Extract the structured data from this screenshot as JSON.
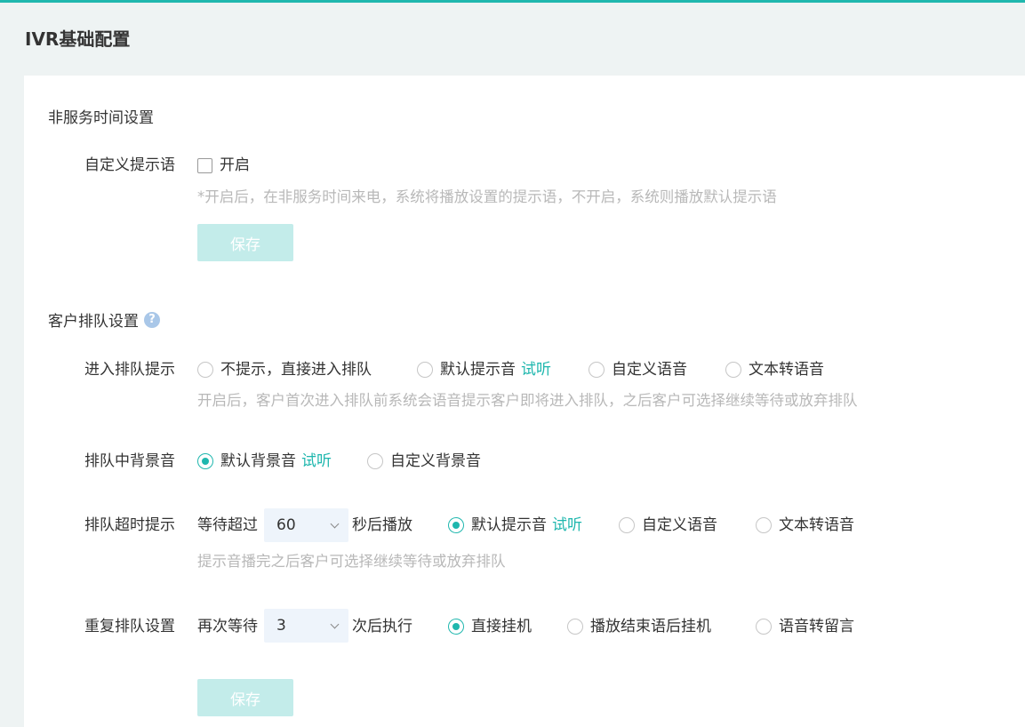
{
  "page": {
    "title": "IVR基础配置"
  },
  "colors": {
    "accent": "#1fb7ae",
    "button_disabled": "#c3ecea",
    "hint": "#b8b8b8"
  },
  "non_service": {
    "section_title": "非服务时间设置",
    "custom_prompt_label": "自定义提示语",
    "enable_label": "开启",
    "enable_checked": false,
    "hint": "*开启后，在非服务时间来电，系统将播放设置的提示语，不开启，系统则播放默认提示语",
    "save_label": "保存"
  },
  "queue": {
    "section_title": "客户排队设置",
    "help_icon": "?",
    "enter_prompt": {
      "label": "进入排队提示",
      "options": [
        {
          "text": "不提示，直接进入排队",
          "checked": false
        },
        {
          "text": "默认提示音",
          "listen": "试听",
          "checked": false
        },
        {
          "text": "自定义语音",
          "checked": false
        },
        {
          "text": "文本转语音",
          "checked": false
        }
      ],
      "hint": "开启后，客户首次进入排队前系统会语音提示客户即将进入排队，之后客户可选择继续等待或放弃排队"
    },
    "background_music": {
      "label": "排队中背景音",
      "options": [
        {
          "text": "默认背景音",
          "listen": "试听",
          "checked": true
        },
        {
          "text": "自定义背景音",
          "checked": false
        }
      ]
    },
    "timeout_prompt": {
      "label": "排队超时提示",
      "prefix": "等待超过",
      "select_value": "60",
      "suffix": "秒后播放",
      "options": [
        {
          "text": "默认提示音",
          "listen": "试听",
          "checked": true
        },
        {
          "text": "自定义语音",
          "checked": false
        },
        {
          "text": "文本转语音",
          "checked": false
        }
      ],
      "hint": "提示音播完之后客户可选择继续等待或放弃排队"
    },
    "repeat": {
      "label": "重复排队设置",
      "prefix": "再次等待",
      "select_value": "3",
      "suffix": "次后执行",
      "options": [
        {
          "text": "直接挂机",
          "checked": true
        },
        {
          "text": "播放结束语后挂机",
          "checked": false
        },
        {
          "text": "语音转留言",
          "checked": false
        }
      ]
    },
    "save_label": "保存"
  }
}
